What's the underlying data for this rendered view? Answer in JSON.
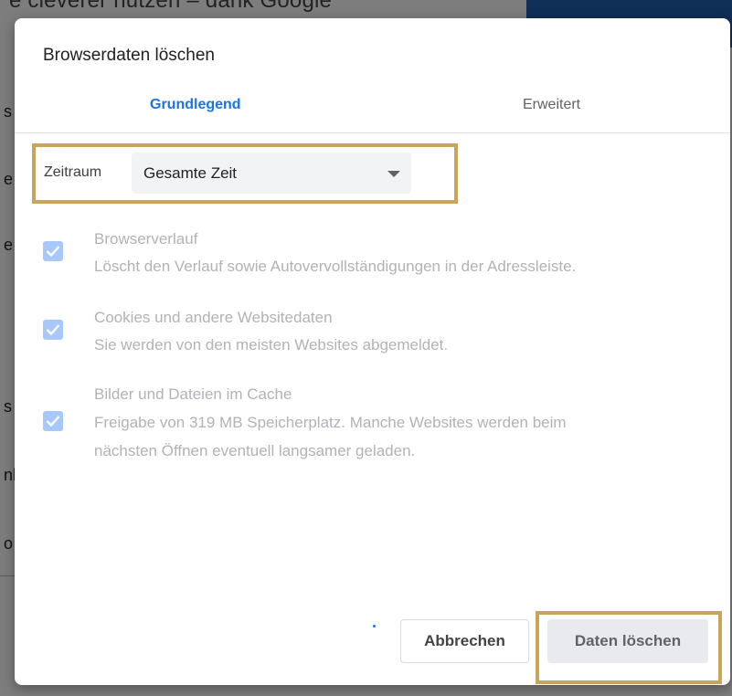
{
  "background": {
    "headline": "e cleverer nutzen – dank Google",
    "fragments": [
      "s",
      "e",
      "e",
      "s",
      "nl",
      "o"
    ]
  },
  "dialog": {
    "title": "Browserdaten löschen",
    "tabs": [
      {
        "label": "Grundlegend",
        "active": true
      },
      {
        "label": "Erweitert",
        "active": false
      }
    ],
    "time_range": {
      "label": "Zeitraum",
      "value": "Gesamte Zeit"
    },
    "items": [
      {
        "title": "Browserverlauf",
        "desc_lines": [
          "Löscht den Verlauf sowie Autovervollständigungen in der Adressleiste."
        ],
        "checked": true
      },
      {
        "title": "Cookies und andere Websitedaten",
        "desc_lines": [
          "Sie werden von den meisten Websites abgemeldet."
        ],
        "checked": true
      },
      {
        "title": "Bilder und Dateien im Cache",
        "desc_lines": [
          "Freigabe von 319 MB Speicherplatz. Manche Websites werden beim",
          "nächsten Öffnen eventuell langsamer geladen."
        ],
        "checked": true
      }
    ],
    "buttons": {
      "cancel": "Abbrechen",
      "delete": "Daten löschen"
    }
  },
  "colors": {
    "accent": "#1a73e8",
    "highlight_border": "#c9a55c",
    "checkbox_disabled": "#a8c7fa"
  }
}
